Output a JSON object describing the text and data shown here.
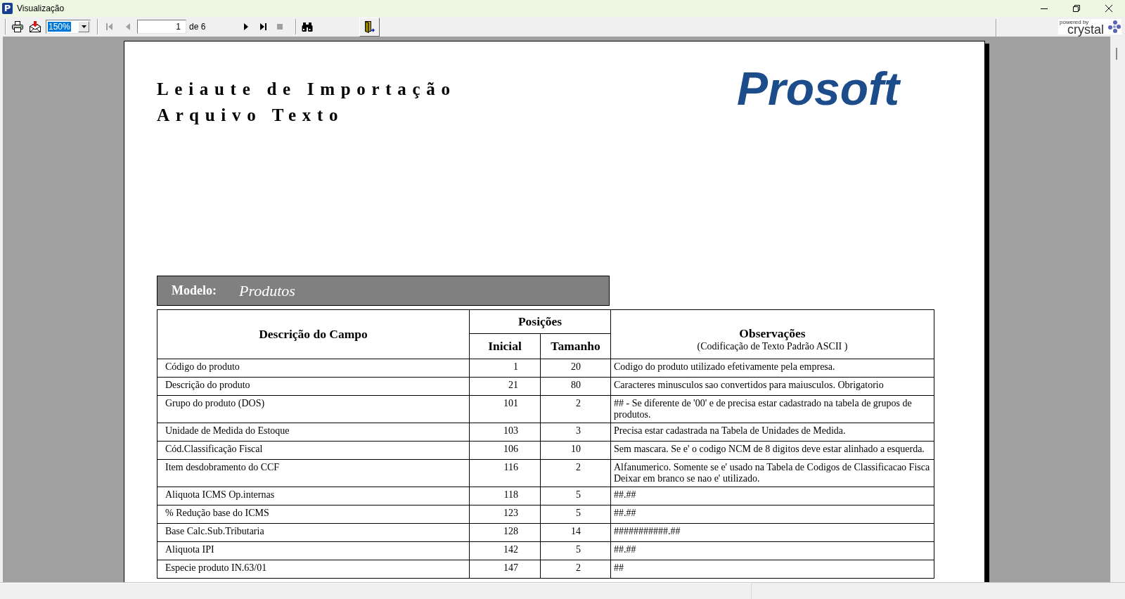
{
  "window": {
    "icon_letter": "P",
    "title": "Visualização"
  },
  "toolbar": {
    "zoom": {
      "value": "150%",
      "text_selected": true
    },
    "navigation_back": [
      {
        "kind": "first",
        "disabled": true
      },
      {
        "kind": "previous",
        "disabled": true
      }
    ],
    "page": {
      "value": "1",
      "count": "de 6"
    },
    "navigation_forward": [
      {
        "kind": "next",
        "disabled": false
      },
      {
        "kind": "last",
        "disabled": false
      },
      {
        "kind": "stop",
        "disabled": true
      }
    ],
    "branding": {
      "tagline": "powered by",
      "name": "crystal"
    }
  },
  "report": {
    "title_lines": [
      "Leiaute de Importação",
      "Arquivo Texto"
    ],
    "logo": "Prosoft",
    "model": {
      "label": "Modelo:",
      "name": "Produtos"
    },
    "table": {
      "columns": {
        "description": "Descrição do Campo",
        "positions": "Posições",
        "start": "Inicial",
        "length": "Tamanho",
        "notes": "Observações",
        "notes_subtitle": "(Codificação de Texto Padrão ASCII )"
      },
      "rows": [
        {
          "description": "Código do produto",
          "start": "1",
          "length": "20",
          "notes": "Codigo do produto utilizado efetivamente pela empresa."
        },
        {
          "description": "Descrição do produto",
          "start": "21",
          "length": "80",
          "notes": "Caracteres minusculos sao convertidos para maiusculos. Obrigatorio"
        },
        {
          "description": "Grupo do produto (DOS)",
          "start": "101",
          "length": "2",
          "notes": "## - Se diferente de '00' e de precisa estar cadastrado na tabela de grupos de\nprodutos."
        },
        {
          "description": "Unidade de Medida do Estoque",
          "start": "103",
          "length": "3",
          "notes": "Precisa estar cadastrada na Tabela de Unidades de Medida."
        },
        {
          "description": "Cód.Classificação Fiscal",
          "start": "106",
          "length": "10",
          "notes": "Sem mascara. Se e' o codigo NCM de 8 digitos deve estar alinhado a esquerda."
        },
        {
          "description": "Item desdobramento do CCF",
          "start": "116",
          "length": "2",
          "notes": "Alfanumerico. Somente se e' usado na Tabela de Codigos de Classificacao Fisca\nDeixar em branco se nao e' utilizado."
        },
        {
          "description": "Aliquota ICMS Op.internas",
          "start": "118",
          "length": "5",
          "notes": "##.##"
        },
        {
          "description": "% Redução base do ICMS",
          "start": "123",
          "length": "5",
          "notes": "##.##"
        },
        {
          "description": "Base Calc.Sub.Tributaria",
          "start": "128",
          "length": "14",
          "notes": "###########.##"
        },
        {
          "description": "Aliquota IPI",
          "start": "142",
          "length": "5",
          "notes": "##.##"
        },
        {
          "description": "Especie produto IN.63/01",
          "start": "147",
          "length": "2",
          "notes": "##"
        }
      ]
    }
  }
}
